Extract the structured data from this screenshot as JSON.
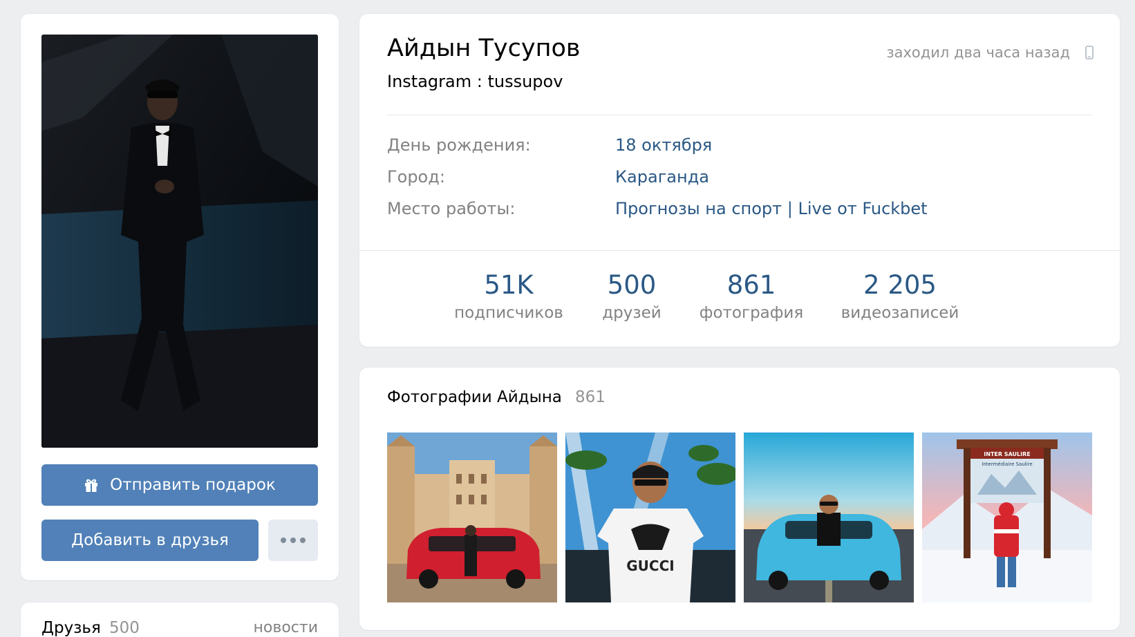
{
  "profile": {
    "name": "Айдын Тусупов",
    "status": "Instagram : tussupov",
    "last_seen": "заходил два часа назад",
    "info": [
      {
        "label": "День рождения:",
        "value": "18 октября"
      },
      {
        "label": "Город:",
        "value": "Караганда"
      },
      {
        "label": "Место работы:",
        "value": "Прогнозы на спорт | Live от Fuckbet"
      }
    ],
    "stats": [
      {
        "value": "51K",
        "label": "подписчиков"
      },
      {
        "value": "500",
        "label": "друзей"
      },
      {
        "value": "861",
        "label": "фотография"
      },
      {
        "value": "2 205",
        "label": "видеозаписей"
      }
    ]
  },
  "actions": {
    "gift_label": "Отправить подарок",
    "add_friend_label": "Добавить в друзья"
  },
  "friends": {
    "title": "Друзья",
    "count": "500",
    "news_link": "новости"
  },
  "photos": {
    "title": "Фотографии Айдына",
    "count": "861",
    "sign_text": "INTER SAULIRE",
    "sign_subtext": "Intermédiaire Saulire",
    "shirt_text": "GUCCI"
  },
  "colors": {
    "accent": "#5181b8",
    "link": "#2a5885",
    "muted": "#828282",
    "background": "#edeef0"
  },
  "icons": {
    "gift": "gift-icon",
    "more": "more-dots-icon",
    "phone": "mobile-phone-icon"
  }
}
